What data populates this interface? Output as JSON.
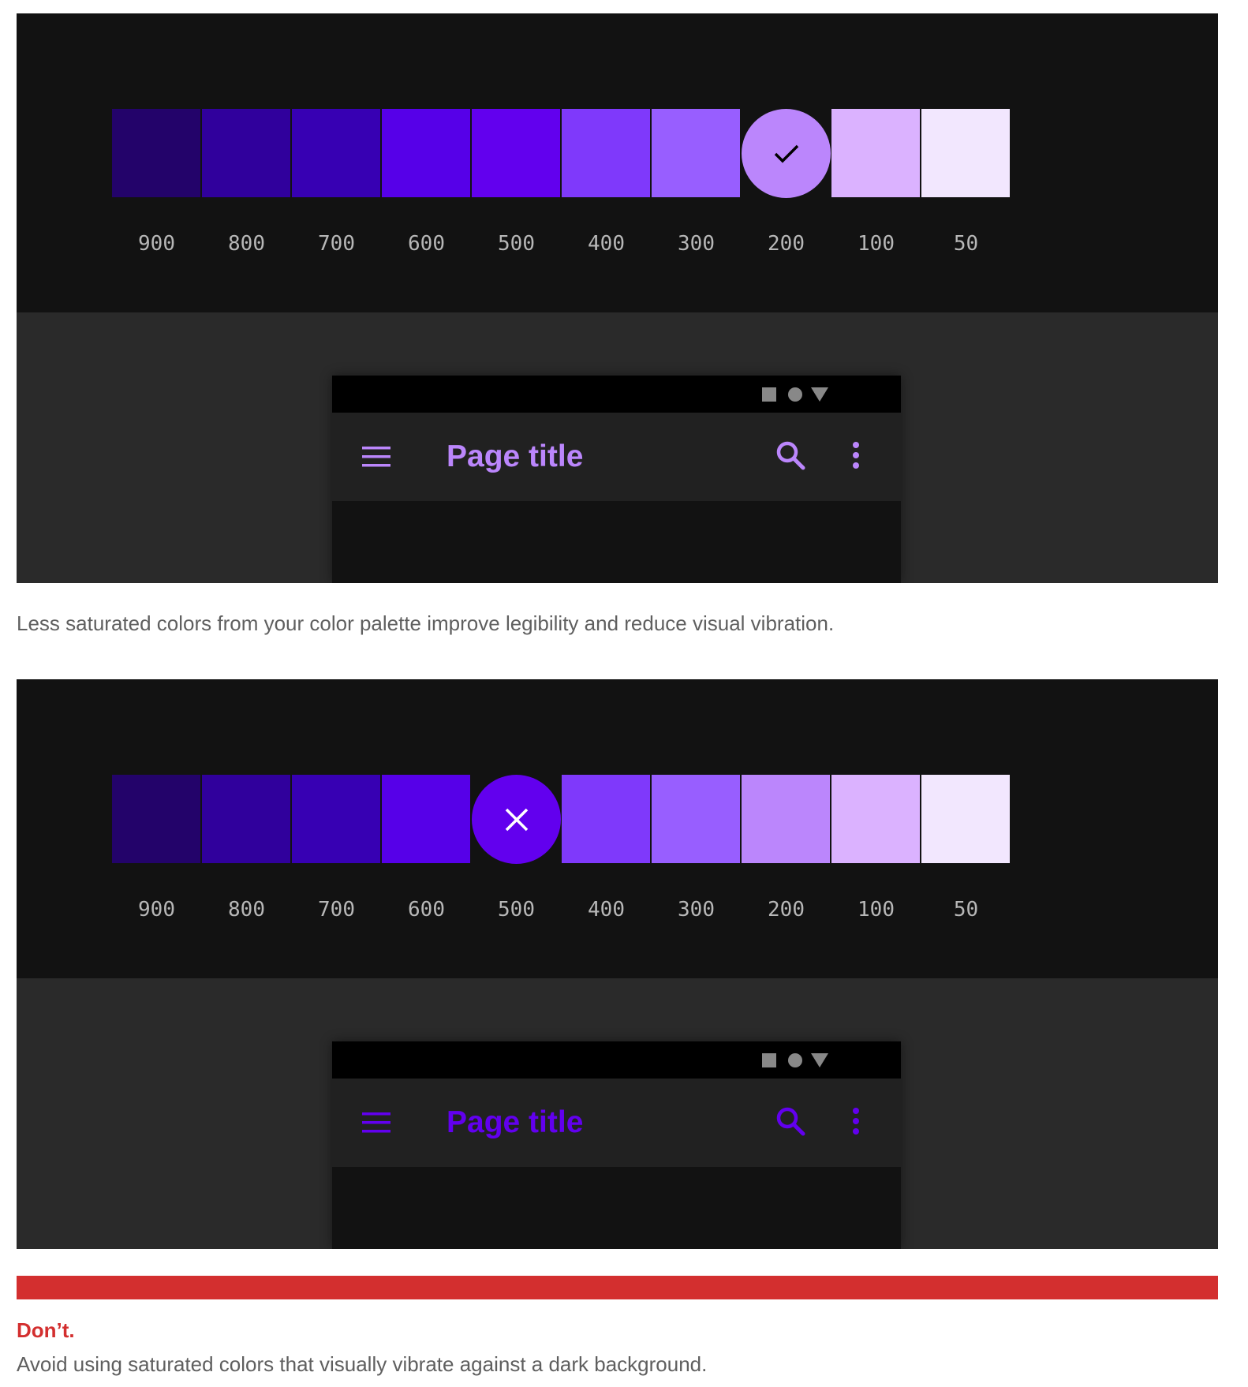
{
  "palette": [
    {
      "label": "900",
      "color": "#23036a"
    },
    {
      "label": "800",
      "color": "#30009c"
    },
    {
      "label": "700",
      "color": "#3700b3"
    },
    {
      "label": "600",
      "color": "#5600e8"
    },
    {
      "label": "500",
      "color": "#6200ee"
    },
    {
      "label": "400",
      "color": "#7f39fb"
    },
    {
      "label": "300",
      "color": "#985eff"
    },
    {
      "label": "200",
      "color": "#bb86fc"
    },
    {
      "label": "100",
      "color": "#dbb2ff"
    },
    {
      "label": "50",
      "color": "#f2e7fe"
    }
  ],
  "figures": [
    {
      "selected_index": 7,
      "marker_icon": "check-icon",
      "marker_icon_color": "#000000",
      "accent_color": "#bb86fc",
      "app_bar": {
        "title": "Page title"
      }
    },
    {
      "selected_index": 4,
      "marker_icon": "close-icon",
      "marker_icon_color": "#ffffff",
      "accent_color": "#6200ee",
      "app_bar": {
        "title": "Page title"
      }
    }
  ],
  "status_bar": {
    "icons": [
      "square-icon",
      "circle-icon",
      "triangle-down-icon"
    ],
    "icon_color": "#888888"
  },
  "caption": "Less saturated colors from your color palette improve legibility and reduce visual vibration.",
  "dont": {
    "title": "Don’t.",
    "text": "Avoid using saturated colors that visually vibrate against a dark background.",
    "color": "#d32f2f"
  }
}
